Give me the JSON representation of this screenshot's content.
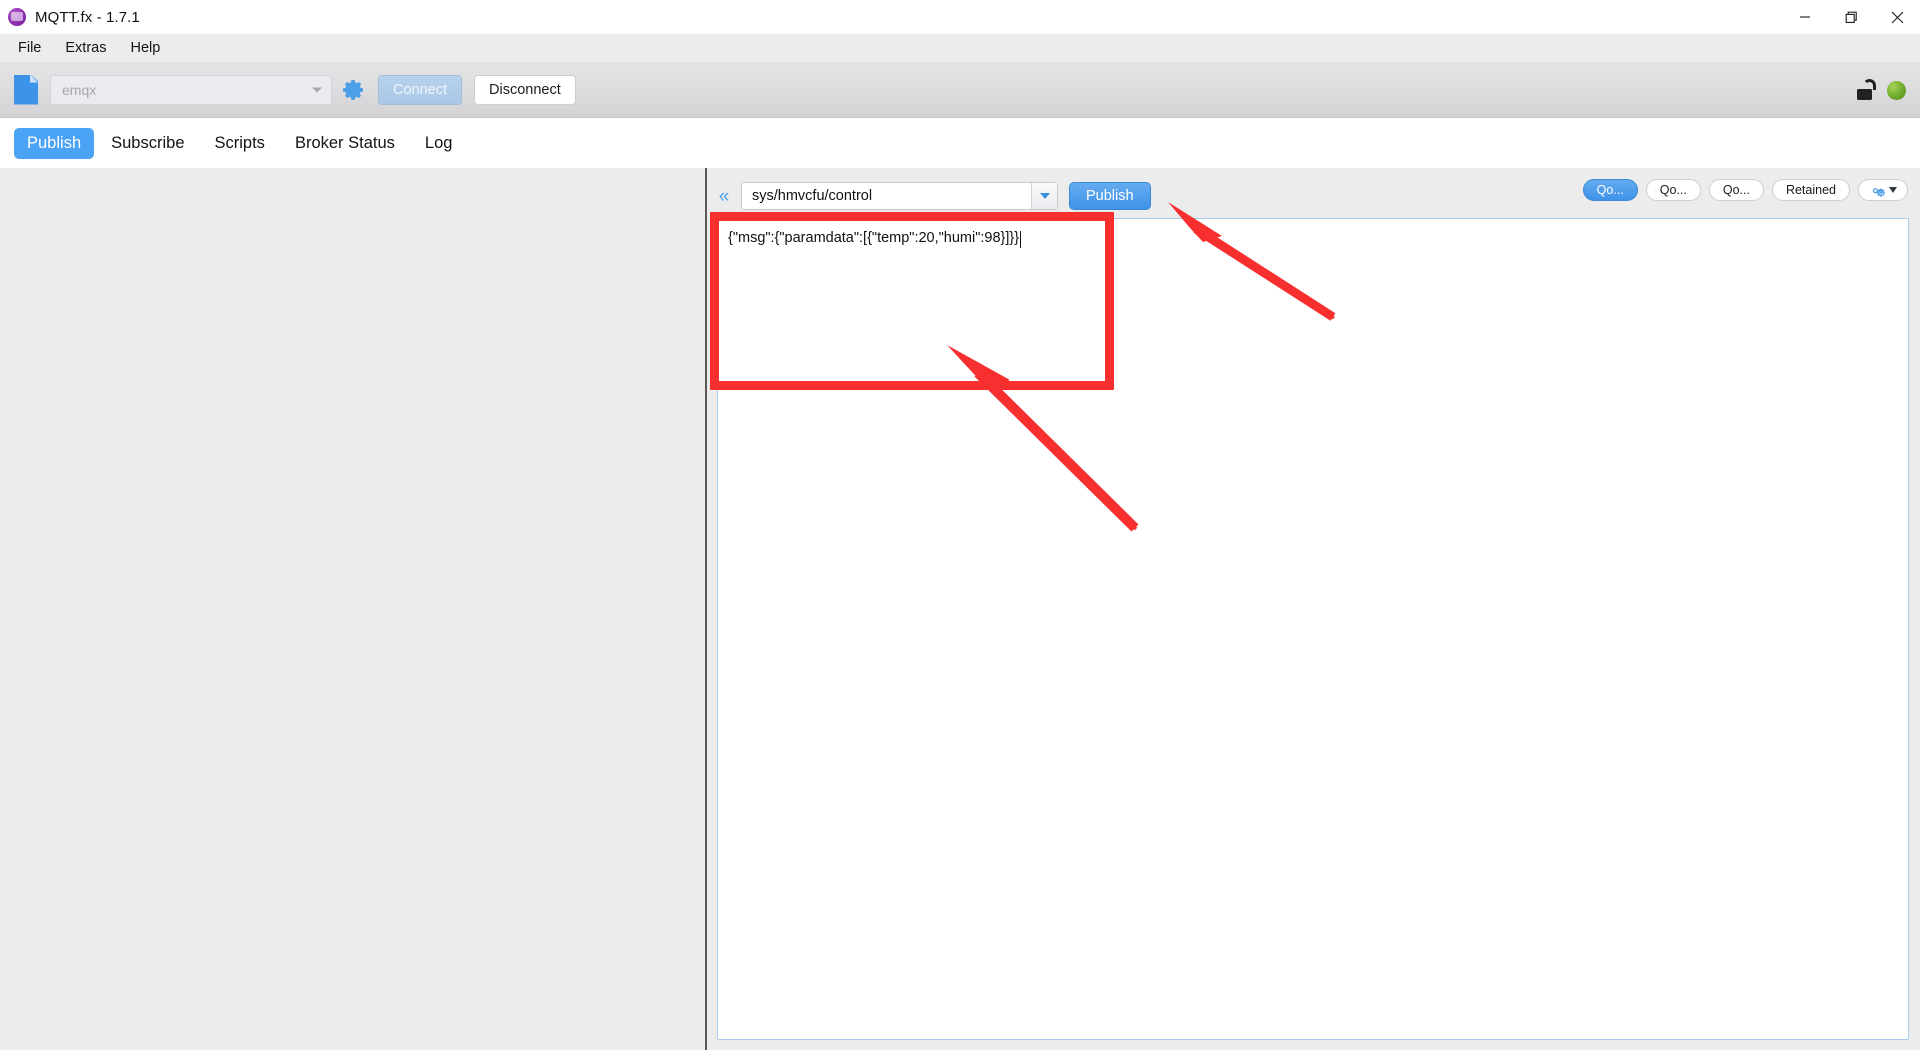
{
  "window": {
    "title": "MQTT.fx - 1.7.1",
    "logo_icon": "mqttfx-logo-icon",
    "controls": {
      "minimize": "minimize-icon",
      "restore": "restore-icon",
      "close": "close-icon"
    }
  },
  "menu": {
    "items": [
      {
        "label": "File"
      },
      {
        "label": "Extras"
      },
      {
        "label": "Help"
      }
    ]
  },
  "toolbar": {
    "file_icon": "file-icon",
    "profile": {
      "value": "emqx",
      "placeholder": "emqx",
      "caret_icon": "chevron-down-icon"
    },
    "gear_icon": "gear-icon",
    "connect_label": "Connect",
    "disconnect_label": "Disconnect",
    "lock_icon": "unlocked-padlock-icon",
    "status_icon": "connected-status-dot",
    "status_color": "#6aa329"
  },
  "tabs": [
    {
      "label": "Publish",
      "active": true
    },
    {
      "label": "Subscribe",
      "active": false
    },
    {
      "label": "Scripts",
      "active": false
    },
    {
      "label": "Broker Status",
      "active": false
    },
    {
      "label": "Log",
      "active": false
    }
  ],
  "publish": {
    "collapse_icon": "double-chevron-left-icon",
    "topic": "sys/hmvcfu/control",
    "topic_caret_icon": "chevron-down-icon",
    "publish_label": "Publish",
    "qos_buttons": [
      {
        "label": "Qo...",
        "active": true
      },
      {
        "label": "Qo...",
        "active": false
      },
      {
        "label": "Qo...",
        "active": false
      }
    ],
    "retained_label": "Retained",
    "settings_icon": "gears-icon",
    "settings_caret_icon": "chevron-down-icon",
    "payload": "{\"msg\":{\"paramdata\":[{\"temp\":20,\"humi\":98}]}}"
  },
  "annotations": {
    "highlight_color": "#f72f2f",
    "box_target": "payload-editor",
    "arrows": [
      {
        "name": "arrow-to-publish-button",
        "points_to": "publish-button"
      },
      {
        "name": "arrow-to-payload-editor",
        "points_to": "payload-editor"
      }
    ]
  }
}
